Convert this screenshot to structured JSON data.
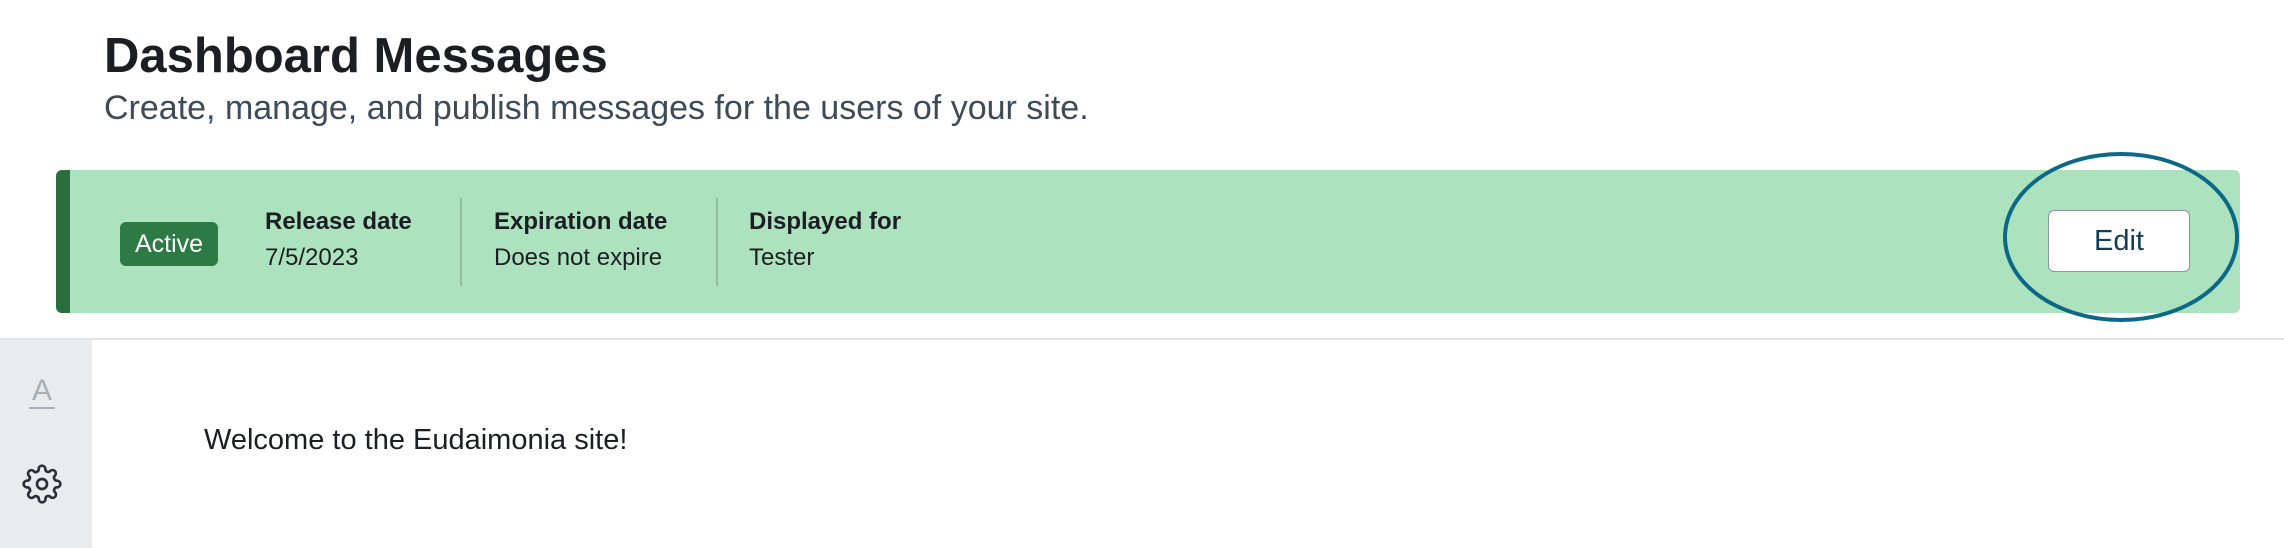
{
  "header": {
    "title": "Dashboard Messages",
    "subtitle": "Create, manage, and publish messages for the users of your site."
  },
  "message": {
    "status": "Active",
    "release_date": {
      "label": "Release date",
      "value": "7/5/2023"
    },
    "expiration_date": {
      "label": "Expiration date",
      "value": "Does not expire"
    },
    "displayed_for": {
      "label": "Displayed for",
      "value": "Tester"
    },
    "edit_label": "Edit",
    "body": "Welcome to the Eudaimonia site!"
  },
  "sidebar": {
    "icons": [
      "font-color-icon",
      "gear-icon"
    ]
  },
  "colors": {
    "banner": "#ade2be",
    "banner_accent": "#2b6f3e",
    "badge": "#2d7a45",
    "highlight": "#0b6886"
  }
}
